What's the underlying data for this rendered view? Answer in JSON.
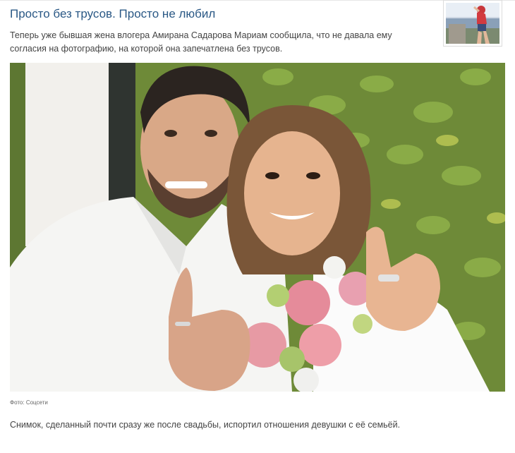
{
  "article": {
    "headline": "Просто без трусов. Просто не любил",
    "lead": "Теперь уже бывшая жена влогера Амирана Садарова Мариам сообщила, что не давала ему согласия на фотографию, на которой она запечатлена без трусов.",
    "photo_credit": "Фото: Соцсети",
    "caption": "Снимок, сделанный почти сразу же после свадьбы, испортил отношения девушки с её семьёй."
  },
  "colors": {
    "headline": "#2a5885",
    "body_text": "#444444",
    "foliage": "#5f7a2e",
    "background": "#ffffff"
  }
}
